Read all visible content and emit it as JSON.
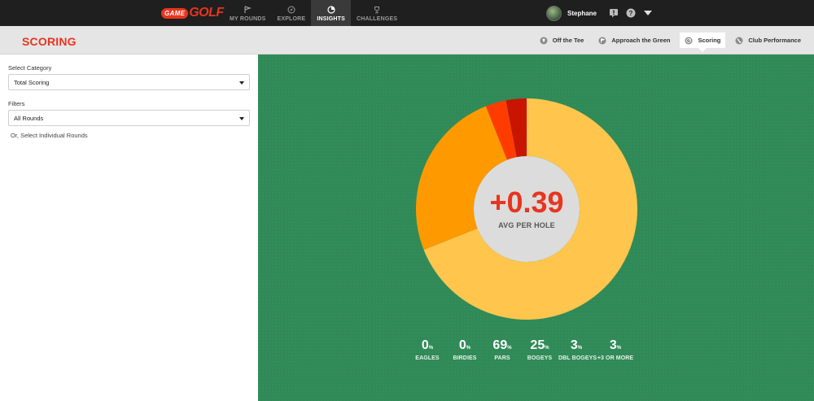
{
  "brand": {
    "game": "GAME",
    "golf": "GOLF"
  },
  "nav": [
    {
      "label": "MY ROUNDS",
      "icon": "flag-icon",
      "active": false
    },
    {
      "label": "EXPLORE",
      "icon": "compass-icon",
      "active": false
    },
    {
      "label": "INSIGHTS",
      "icon": "insights-icon",
      "active": true
    },
    {
      "label": "CHALLENGES",
      "icon": "trophy-icon",
      "active": false
    }
  ],
  "user": {
    "name": "Stephane"
  },
  "header": {
    "title": "SCORING"
  },
  "tabs": [
    {
      "label": "Off the Tee",
      "icon": "tee-icon",
      "active": false
    },
    {
      "label": "Approach the Green",
      "icon": "approach-icon",
      "active": false
    },
    {
      "label": "Scoring",
      "icon": "scoring-icon",
      "active": true
    },
    {
      "label": "Club Performance",
      "icon": "club-icon",
      "active": false
    }
  ],
  "sidebar": {
    "category_label": "Select Category",
    "category_value": "Total Scoring",
    "filters_label": "Filters",
    "filters_value": "All Rounds",
    "individual_rounds_link": "Or, Select Individual Rounds"
  },
  "summary": {
    "value": "+0.39",
    "label": "AVG PER HOLE"
  },
  "colors": {
    "accent": "#e8351f",
    "background": "#2f8a57"
  },
  "chart_data": {
    "type": "pie",
    "categories": [
      "EAGLES",
      "BIRDIES",
      "PARS",
      "BOGEYS",
      "DBL BOGEYS",
      "+3 OR MORE"
    ],
    "values": [
      0,
      0,
      69,
      25,
      3,
      3
    ],
    "unit": "%",
    "colors": [
      "#ffd966",
      "#ffe08a",
      "#ffc54d",
      "#ff9900",
      "#ff3c00",
      "#c81500"
    ]
  }
}
